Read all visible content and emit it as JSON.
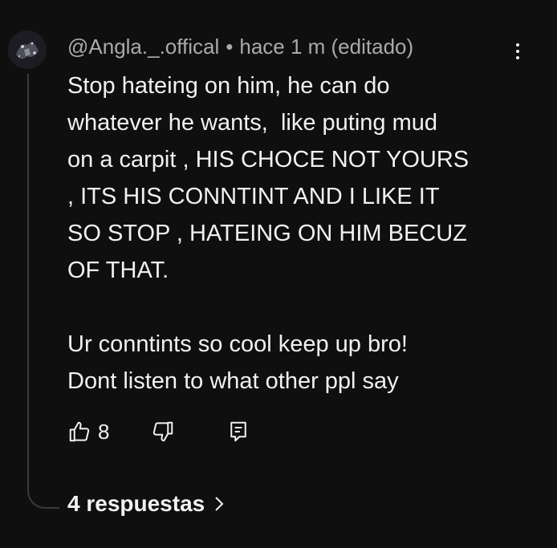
{
  "comment": {
    "author": "@Angla._.offical",
    "separator": "•",
    "timestamp": "hace 1 m (editado)",
    "body": "Stop hateing on him, he can do\nwhatever he wants,  like puting mud\non a carpit , HIS CHOCE NOT YOURS\n, ITS HIS CONNTINT AND I LIKE IT\nSO STOP , HATEING ON HIM BECUZ\nOF THAT.\n\nUr conntints so cool keep up bro!\nDont listen to what other ppl say",
    "like_count": "8"
  },
  "replies": {
    "label": "4 respuestas"
  },
  "icons": {
    "like": "thumbs-up-icon",
    "dislike": "thumbs-down-icon",
    "reply": "reply-icon",
    "menu": "more-vertical-icon",
    "expand": "chevron-right-icon"
  },
  "colors": {
    "background": "#0f0f0f",
    "text": "#f1f1f1",
    "secondary_text": "#aaaaaa",
    "thread_line": "#3a3a3a"
  }
}
